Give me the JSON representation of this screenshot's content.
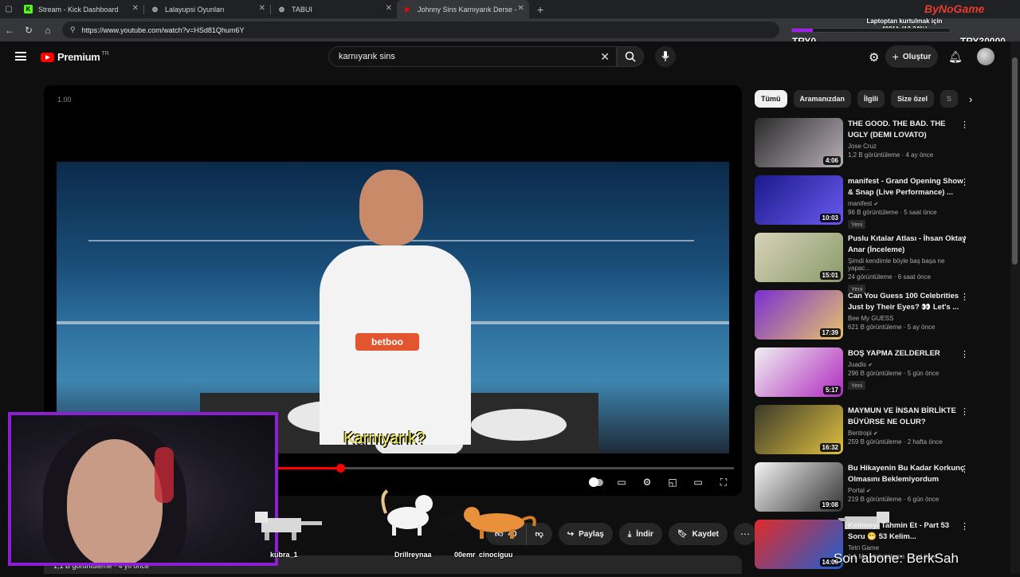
{
  "browser": {
    "tabs": [
      {
        "title": "Stream - Kick Dashboard",
        "fav": "K",
        "fav_color": "#53fc18"
      },
      {
        "title": "Lalayupsi Oyunları",
        "fav": "◍",
        "fav_color": "#bbbbbb"
      },
      {
        "title": "TABUI",
        "fav": "◍",
        "fav_color": "#bbbbbb"
      },
      {
        "title": "Johnny Sins Karnıyarık Derse - Yo",
        "fav": "▶",
        "fav_color": "#ff0000"
      }
    ],
    "url": "https://www.youtube.com/watch?v=HSd81Qhum6Y"
  },
  "overlay": {
    "brand": "ByNoGame",
    "goal_title": "Laptoptan kurtulmak için",
    "goal_progress": "4001₺ (13.34%)",
    "goal_fraction": 0.1334,
    "goal_start": "TRY0",
    "goal_end": "TRY30000",
    "sub_alert": "Son abone: BerkSah"
  },
  "youtube": {
    "brand": "Premium",
    "region": "TR",
    "search_query": "karnıyarık sins",
    "create_label": "Oluştur"
  },
  "player": {
    "speed_readout": "1.00",
    "subtitle": "Karnıyarık?",
    "shirt_logo": "betboo",
    "progress_fraction": 0.42
  },
  "actions": {
    "like_count": "40",
    "share": "Paylaş",
    "download": "İndir",
    "save": "Kaydet"
  },
  "description_strip": "1,1 B görüntüleme · 4 yıl önce",
  "chat_pets": [
    "kubra_1",
    "Drillreynaa",
    "00emr",
    "cinociguu"
  ],
  "chips": [
    "Tümü",
    "Aramanızdan",
    "İlgili",
    "Size özel",
    "S"
  ],
  "recommendations": [
    {
      "title": "THE GOOD. THE BAD.  THE UGLY (DEMI LOVATO)",
      "channel": "Jose Cruz",
      "meta": "1,2 B görüntüleme · 4 ay önce",
      "duration": "4:06",
      "badge": "",
      "verified": false,
      "colors": [
        "#2a2a2a",
        "#b8b0b8"
      ]
    },
    {
      "title": "manifest - Grand Opening Show & Snap (Live Performance) ...",
      "channel": "manifest",
      "meta": "96 B görüntüleme · 5 saat önce",
      "duration": "10:03",
      "badge": "Yeni",
      "verified": true,
      "colors": [
        "#1a1a8a",
        "#6a5af0"
      ]
    },
    {
      "title": "Puslu Kıtalar Atlası - İhsan Oktay Anar (İnceleme)",
      "channel": "Şimdi kendimle böyle baş başa ne yapac...",
      "meta": "24 görüntüleme · 6 saat önce",
      "duration": "15:01",
      "badge": "Yeni",
      "verified": false,
      "colors": [
        "#d7d3b8",
        "#8a9a6a"
      ]
    },
    {
      "title": "Can You Guess 100 Celebrities Just by Their Eyes? 👀 Let's ...",
      "channel": "Bee My GUESS",
      "meta": "621 B görüntüleme · 5 ay önce",
      "duration": "17:39",
      "badge": "",
      "verified": false,
      "colors": [
        "#7a2fd0",
        "#e7c36a"
      ]
    },
    {
      "title": "BOŞ YAPMA ZELDERLER",
      "channel": "Juadis",
      "meta": "296 B görüntüleme · 5 gün önce",
      "duration": "5:17",
      "badge": "Yeni",
      "verified": true,
      "colors": [
        "#f0f0f0",
        "#b02ac0"
      ]
    },
    {
      "title": "MAYMUN VE İNSAN BİRLİKTE BÜYÜRSE NE OLUR?",
      "channel": "Bentropi",
      "meta": "259 B görüntüleme · 2 hafta önce",
      "duration": "16:32",
      "badge": "",
      "verified": true,
      "colors": [
        "#3a3a2a",
        "#e0c040"
      ]
    },
    {
      "title": "Bu Hikayenin Bu Kadar Korkunç Olmasını Beklemiyordum",
      "channel": "Portal",
      "meta": "219 B görüntüleme · 6 gün önce",
      "duration": "19:08",
      "badge": "",
      "verified": true,
      "colors": [
        "#f4f4f4",
        "#333333"
      ]
    },
    {
      "title": "Kelimeyi Tahmin Et - Part 53 Soru 😁 53 Kelim...",
      "channel": "Tetri Game",
      "meta": "1,1 Mn görüntüleme · 2 yıl önce",
      "duration": "14:06",
      "badge": "",
      "verified": false,
      "colors": [
        "#e02b2b",
        "#1f5fd0"
      ]
    }
  ]
}
